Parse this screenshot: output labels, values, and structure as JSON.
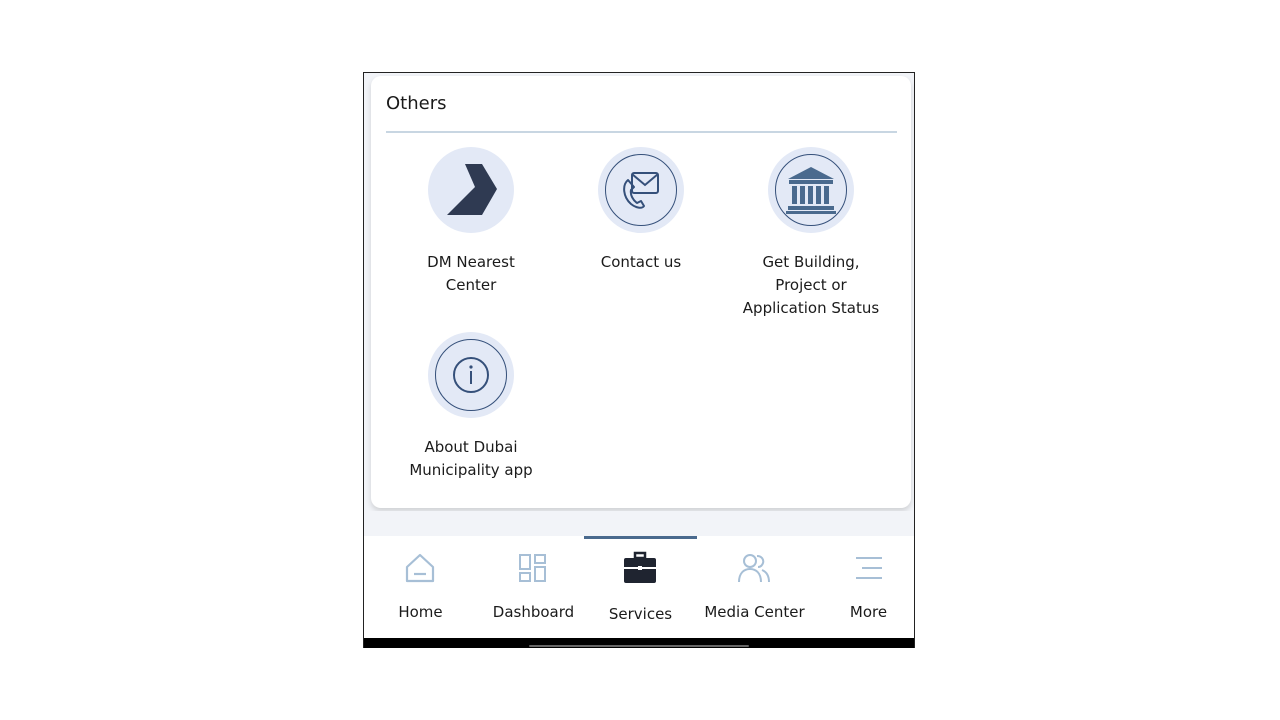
{
  "section": {
    "title": "Others"
  },
  "tiles": [
    {
      "label": "DM Nearest\nCenter",
      "icon": "dm-logo-icon"
    },
    {
      "label": "Contact us",
      "icon": "contact-mail-phone-icon"
    },
    {
      "label": "Get Building,\nProject  or\nApplication Status",
      "icon": "government-building-icon"
    },
    {
      "label": "About Dubai\nMunicipality app",
      "icon": "info-icon"
    }
  ],
  "tabs": [
    {
      "label": "Home",
      "icon": "home-icon"
    },
    {
      "label": "Dashboard",
      "icon": "dashboard-icon"
    },
    {
      "label": "Services",
      "icon": "briefcase-icon",
      "active": true
    },
    {
      "label": "Media Center",
      "icon": "people-icon"
    },
    {
      "label": "More",
      "icon": "menu-icon"
    }
  ],
  "colors": {
    "accent": "#4a6a8e",
    "icon_dark": "#35507a",
    "circle_bg": "#e3e9f6",
    "inactive_icon": "#a7bfd6"
  }
}
